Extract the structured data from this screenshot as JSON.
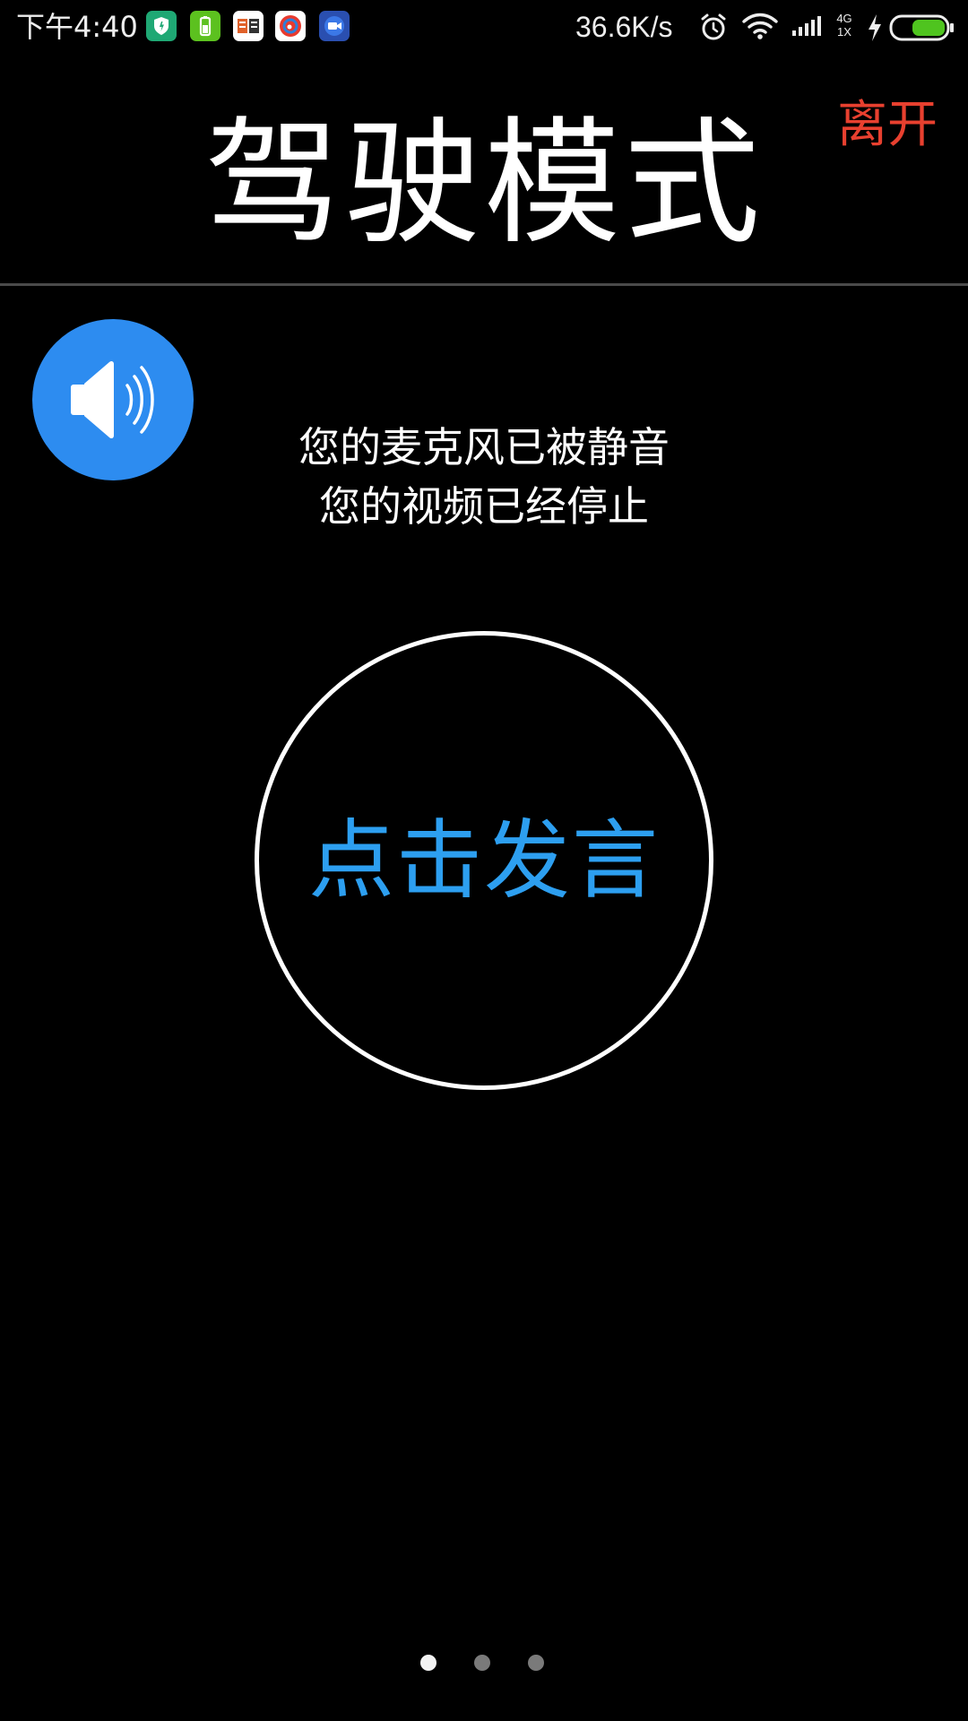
{
  "status_bar": {
    "time": "下午4:40",
    "network_speed": "36.6K/s",
    "network_type_top": "4G",
    "network_type_bottom": "1X",
    "notification_icons": [
      "security-shield-icon",
      "battery-manager-icon",
      "news-app-icon",
      "weibo-icon",
      "meeting-app-icon"
    ],
    "status_icons": [
      "alarm-icon",
      "wifi-icon",
      "signal-icon",
      "charging-icon",
      "battery-icon"
    ]
  },
  "header": {
    "title": "驾驶模式",
    "leave_label": "离开"
  },
  "speaker": {
    "icon": "speaker-volume-icon",
    "color": "#2d8cf0"
  },
  "status_messages": {
    "mic_status": "您的麦克风已被静音",
    "video_status": "您的视频已经停止"
  },
  "talk": {
    "label": "点击发言",
    "color": "#2d9ff0"
  },
  "pager": {
    "count": 3,
    "active_index": 0
  },
  "colors": {
    "background": "#000000",
    "accent_blue": "#2d8cf0",
    "leave_red": "#e8402f"
  }
}
